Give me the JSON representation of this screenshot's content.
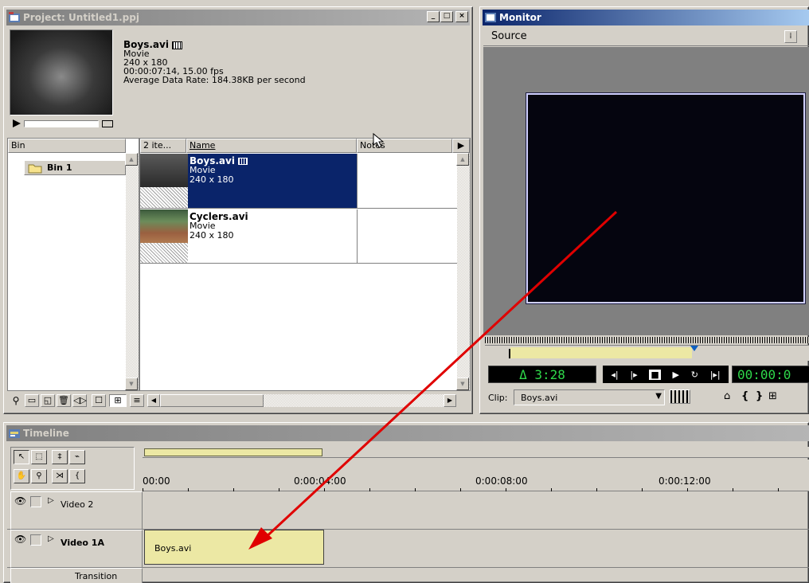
{
  "project": {
    "title": "Project: Untitled1.ppj",
    "clip_name": "Boys.avi",
    "clip_type": "Movie",
    "clip_dims": "240 x 180",
    "clip_duration": "00:00:07:14, 15.00 fps",
    "clip_rate": "Average Data Rate: 184.38KB per second",
    "bin_header": "Bin",
    "count_header": "2 ite...",
    "name_header": "Name",
    "notes_header": "Notes",
    "bin_item": "Bin 1",
    "items": [
      {
        "name": "Boys.avi",
        "type": "Movie",
        "dims": "240 x 180",
        "selected": true
      },
      {
        "name": "Cyclers.avi",
        "type": "Movie",
        "dims": "240 x 180",
        "selected": false
      }
    ]
  },
  "monitor": {
    "title": "Monitor",
    "source_label": "Source",
    "duration": "Δ 3:28",
    "timecode": "00:00:0",
    "clip_label": "Clip:",
    "clip_value": "Boys.avi"
  },
  "timeline": {
    "title": "Timeline",
    "ruler": [
      "00:00",
      "0:00:04:00",
      "0:00:08:00",
      "0:00:12:00"
    ],
    "tracks": [
      {
        "label": "Video 2"
      },
      {
        "label": "Video 1A"
      },
      {
        "label": "Transition"
      }
    ],
    "clip_on_track": "Boys.avi"
  },
  "colors": {
    "selection": "#0a246a",
    "clip": "#ece8a4",
    "arrow": "#e00000",
    "timecode_green": "#2fd84a"
  }
}
